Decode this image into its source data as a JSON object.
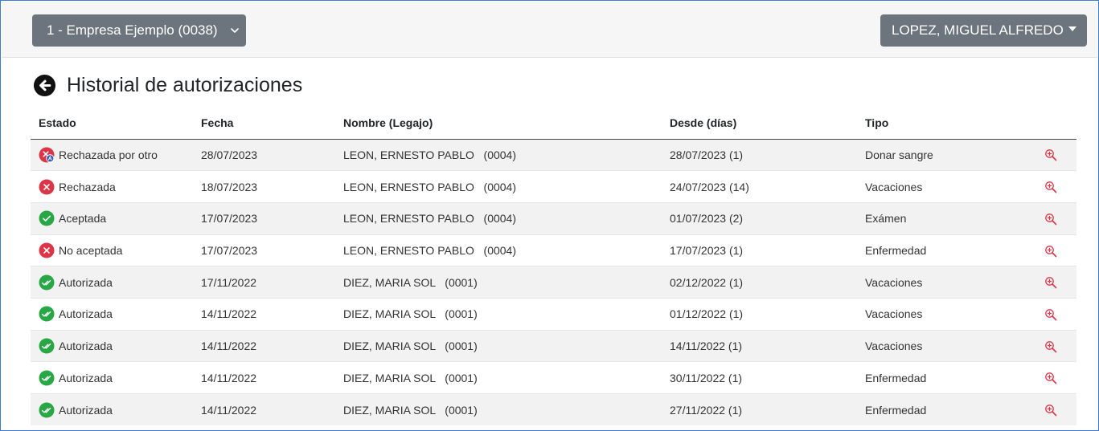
{
  "header": {
    "company_select": "1 - Empresa Ejemplo (0038)",
    "user_menu": "LOPEZ, MIGUEL ALFREDO"
  },
  "page": {
    "title": "Historial de autorizaciones"
  },
  "table": {
    "columns": [
      "Estado",
      "Fecha",
      "Nombre (Legajo)",
      "Desde (días)",
      "Tipo"
    ],
    "rows": [
      {
        "estado": "Rechazada por otro",
        "status_icon": "rejected-by-other-icon",
        "fecha": "28/07/2023",
        "nombre": "LEON, ERNESTO PABLO   (0004)",
        "desde": "28/07/2023 (1)",
        "tipo": "Donar sangre"
      },
      {
        "estado": "Rechazada",
        "status_icon": "rejected-icon",
        "fecha": "18/07/2023",
        "nombre": "LEON, ERNESTO PABLO   (0004)",
        "desde": "24/07/2023 (14)",
        "tipo": "Vacaciones"
      },
      {
        "estado": "Aceptada",
        "status_icon": "accepted-icon",
        "fecha": "17/07/2023",
        "nombre": "LEON, ERNESTO PABLO   (0004)",
        "desde": "01/07/2023 (2)",
        "tipo": "Exámen"
      },
      {
        "estado": "No aceptada",
        "status_icon": "rejected-icon",
        "fecha": "17/07/2023",
        "nombre": "LEON, ERNESTO PABLO   (0004)",
        "desde": "17/07/2023 (1)",
        "tipo": "Enfermedad"
      },
      {
        "estado": "Autorizada",
        "status_icon": "authorized-icon",
        "fecha": "17/11/2022",
        "nombre": "DIEZ, MARIA SOL   (0001)",
        "desde": "02/12/2022 (1)",
        "tipo": "Vacaciones"
      },
      {
        "estado": "Autorizada",
        "status_icon": "authorized-icon",
        "fecha": "14/11/2022",
        "nombre": "DIEZ, MARIA SOL   (0001)",
        "desde": "01/12/2022 (1)",
        "tipo": "Vacaciones"
      },
      {
        "estado": "Autorizada",
        "status_icon": "authorized-icon",
        "fecha": "14/11/2022",
        "nombre": "DIEZ, MARIA SOL   (0001)",
        "desde": "14/11/2022 (1)",
        "tipo": "Vacaciones"
      },
      {
        "estado": "Autorizada",
        "status_icon": "authorized-icon",
        "fecha": "14/11/2022",
        "nombre": "DIEZ, MARIA SOL   (0001)",
        "desde": "30/11/2022 (1)",
        "tipo": "Enfermedad"
      },
      {
        "estado": "Autorizada",
        "status_icon": "authorized-icon",
        "fecha": "14/11/2022",
        "nombre": "DIEZ, MARIA SOL   (0001)",
        "desde": "27/11/2022 (1)",
        "tipo": "Enfermedad"
      }
    ]
  },
  "colors": {
    "button_bg": "#6c757d",
    "accepted_green": "#28a745",
    "rejected_red": "#dc3545",
    "zoom_red": "#dc3545",
    "frame_blue": "#3d7bd6"
  }
}
